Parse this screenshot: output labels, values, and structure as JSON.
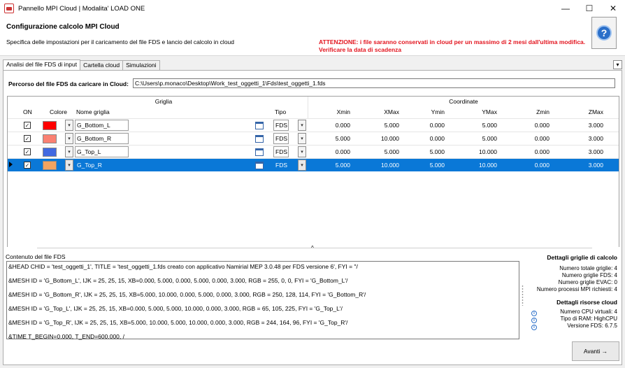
{
  "window": {
    "title": "Pannello MPI Cloud | Modalita' LOAD ONE",
    "minimize": "—",
    "maximize": "☐",
    "close": "✕"
  },
  "header": {
    "title": "Configurazione calcolo MPI Cloud",
    "subtitle": "Specifica delle impostazioni per il caricamento del file FDS e lancio del calcolo in cloud",
    "warning_line1": "ATTENZIONE: i file saranno conservati in cloud per un massimo di 2 mesi dall'ultima modifica.",
    "warning_line2": "Verificare la data di scadenza",
    "help": "?"
  },
  "tabs": [
    {
      "label": "Analisi del file FDS di input"
    },
    {
      "label": "Cartella cloud"
    },
    {
      "label": "Simulazioni"
    }
  ],
  "path": {
    "label": "Percorso del file FDS da caricare in Cloud:",
    "value": "C:\\Users\\p.monaco\\Desktop\\Work_test_oggetti_1\\Fds\\test_oggetti_1.fds"
  },
  "grid": {
    "group_griglia": "Griglia",
    "group_coordinate": "Coordinate",
    "columns": {
      "on": "ON",
      "colore": "Colore",
      "nome": "Nome griglia",
      "tipo": "Tipo",
      "xmin": "Xmin",
      "xmax": "XMax",
      "ymin": "Ymin",
      "ymax": "YMax",
      "zmin": "Zmin",
      "zmax": "ZMax"
    },
    "rows": [
      {
        "on": "✓",
        "color": "#ff0000",
        "name": "G_Bottom_L",
        "tipo": "FDS",
        "xmin": "0.000",
        "xmax": "5.000",
        "ymin": "0.000",
        "ymax": "5.000",
        "zmin": "0.000",
        "zmax": "3.000"
      },
      {
        "on": "✓",
        "color": "#fa8072",
        "name": "G_Bottom_R",
        "tipo": "FDS",
        "xmin": "5.000",
        "xmax": "10.000",
        "ymin": "0.000",
        "ymax": "5.000",
        "zmin": "0.000",
        "zmax": "3.000"
      },
      {
        "on": "✓",
        "color": "#4169e1",
        "name": "G_Top_L",
        "tipo": "FDS",
        "xmin": "0.000",
        "xmax": "5.000",
        "ymin": "5.000",
        "ymax": "10.000",
        "zmin": "0.000",
        "zmax": "3.000"
      },
      {
        "on": "✓",
        "color": "#f4a460",
        "name": "G_Top_R",
        "tipo": "FDS",
        "xmin": "5.000",
        "xmax": "10.000",
        "ymin": "5.000",
        "ymax": "10.000",
        "zmin": "0.000",
        "zmax": "3.000"
      }
    ],
    "selected_row": 3
  },
  "content": {
    "label": "Contenuto del file FDS",
    "lines": [
      "&HEAD CHID = 'test_oggetti_1', TITLE = 'test_oggetti_1.fds creato con applicativo Namirial MEP 3.0.48 per FDS versione 6', FYI = \"/",
      "&MESH ID = 'G_Bottom_L', IJK = 25, 25, 15, XB=0.000, 5.000, 0.000, 5.000, 0.000, 3.000, RGB = 255, 0, 0, FYI = 'G_Bottom_L'/",
      "&MESH ID = 'G_Bottom_R', IJK = 25, 25, 15, XB=5.000, 10.000, 0.000, 5.000, 0.000, 3.000, RGB = 250, 128, 114, FYI = 'G_Bottom_R'/",
      "&MESH ID = 'G_Top_L', IJK = 25, 25, 15, XB=0.000, 5.000, 5.000, 10.000, 0.000, 3.000, RGB = 65, 105, 225, FYI = 'G_Top_L'/",
      "&MESH ID = 'G_Top_R', IJK = 25, 25, 15, XB=5.000, 10.000, 5.000, 10.000, 0.000, 3.000, RGB = 244, 164, 96, FYI = 'G_Top_R'/",
      "&TIME T_BEGIN=0.000,  T_END=600.000, /"
    ]
  },
  "details": {
    "grid_title": "Dettagli griglie di calcolo",
    "grid_lines": [
      "Numero totale griglie: 4",
      "Numero griglie FDS: 4",
      "Numero griglie EVAC: 0",
      "Numero processi MPI richiesti: 4"
    ],
    "cloud_title": "Dettagli risorse cloud",
    "cloud_lines": [
      "Numero CPU virtuali: 4",
      "Tipo di RAM: HighCPU",
      "Versione FDS: 6.7.5"
    ]
  },
  "buttons": {
    "next": "Avanti →"
  }
}
